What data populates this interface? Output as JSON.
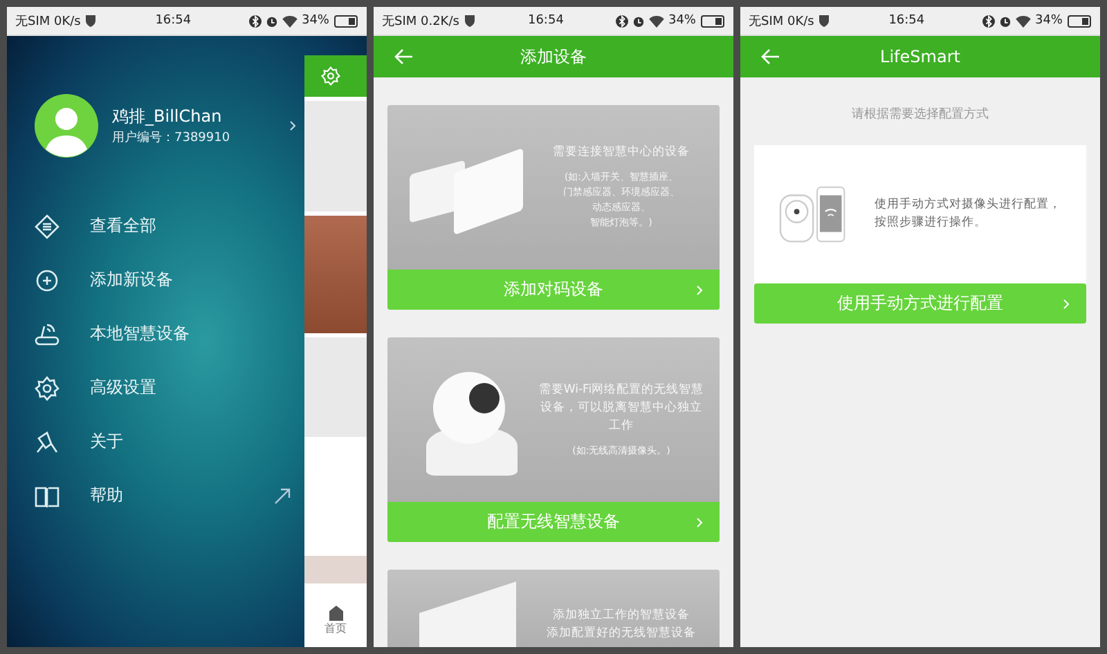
{
  "phones": [
    {
      "kind": "drawer",
      "status": {
        "network": "无SIM 0K/s",
        "time": "16:54",
        "battery": "34%"
      },
      "profile": {
        "name": "鸡排_BillChan",
        "user_id": "用户编号：7389910"
      },
      "menu": [
        {
          "label": "查看全部",
          "external": false
        },
        {
          "label": "添加新设备",
          "external": false
        },
        {
          "label": "本地智慧设备",
          "external": false
        },
        {
          "label": "高级设置",
          "external": false
        },
        {
          "label": "关于",
          "external": false
        },
        {
          "label": "帮助",
          "external": true
        }
      ],
      "behind": {
        "nav_label": "首页"
      }
    },
    {
      "kind": "cards",
      "status": {
        "network": "无SIM 0.2K/s",
        "time": "16:54",
        "battery": "34%"
      },
      "title": "添加设备",
      "cards": [
        {
          "heading": [
            "需要连接智慧中心的设备"
          ],
          "note": [
            "(如:入墙开关、智慧插座、",
            "门禁感应器、环境感应器、",
            "动态感应器、",
            "智能灯泡等。)"
          ],
          "button": "添加对码设备"
        },
        {
          "heading": [
            "需要Wi-Fi网络配置的无线智慧",
            "设备，可以脱离智慧中心独立",
            "工作"
          ],
          "note": [
            "(如:无线高清摄像头。)"
          ],
          "button": "配置无线智慧设备"
        },
        {
          "heading": [
            "添加独立工作的智慧设备",
            "添加配置好的无线智慧设备"
          ]
        }
      ]
    },
    {
      "kind": "config",
      "status": {
        "network": "无SIM 0K/s",
        "time": "16:54",
        "battery": "34%"
      },
      "title": "LifeSmart",
      "hint": "请根据需要选择配置方式",
      "option": {
        "text": [
          "使用手动方式对摄像头进行配置，",
          "按照步骤进行操作。"
        ],
        "button": "使用手动方式进行配置"
      }
    }
  ]
}
